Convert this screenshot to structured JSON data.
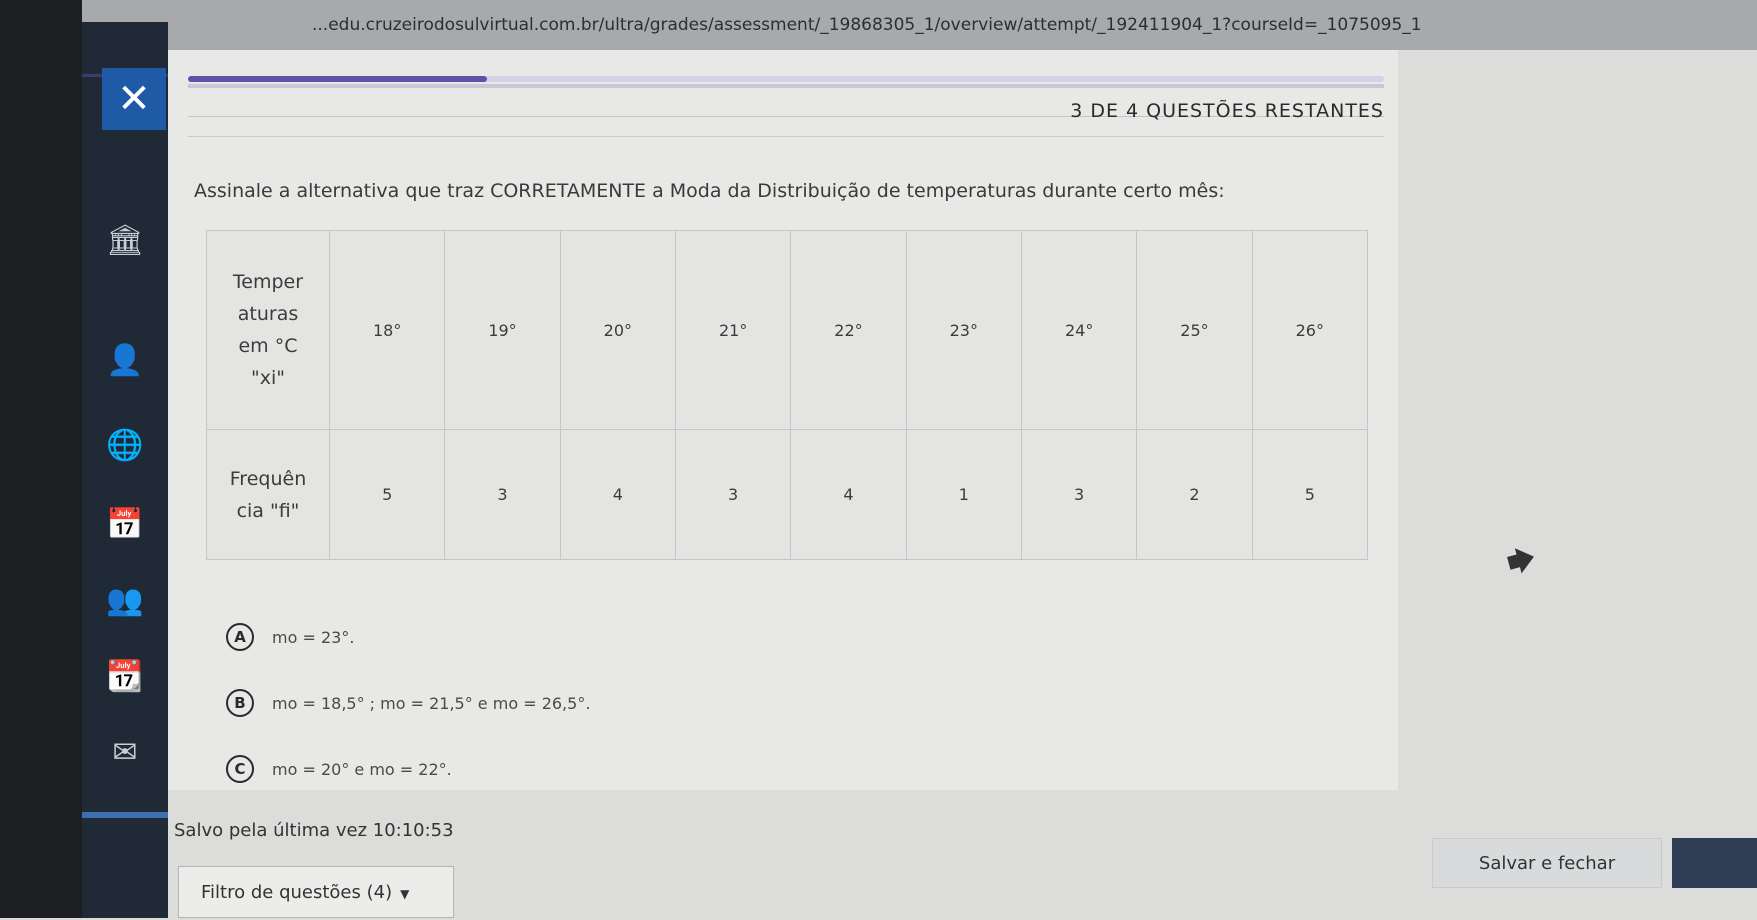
{
  "browser": {
    "url": "...edu.cruzeirodosulvirtual.com.br/ultra/grades/assessment/_19868305_1/overview/attempt/_192411904_1?courseId=_1075095_1"
  },
  "header": {
    "remaining": "3 DE 4 QUESTÕES RESTANTES",
    "progress_fraction": 0.25
  },
  "question": {
    "prompt": "Assinale a alternativa que traz CORRETAMENTE a Moda da Distribuição de temperaturas durante certo mês:",
    "table": {
      "row1_label": "Temper\naturas\nem °C\n\"xi\"",
      "row2_label": "Frequên\ncia \"fi\"",
      "temperatures": [
        "18°",
        "19°",
        "20°",
        "21°",
        "22°",
        "23°",
        "24°",
        "25°",
        "26°"
      ],
      "frequencies": [
        "5",
        "3",
        "4",
        "3",
        "4",
        "1",
        "3",
        "2",
        "5"
      ]
    },
    "options": [
      {
        "letter": "A",
        "text": "mo = 23°."
      },
      {
        "letter": "B",
        "text": "mo = 18,5° ; mo = 21,5° e mo = 26,5°."
      },
      {
        "letter": "C",
        "text": "mo = 20° e mo = 22°."
      }
    ]
  },
  "footer": {
    "saved_label": "Salvo pela última vez 10:10:53",
    "filter_label": "Filtro de questões (4)",
    "save_close_label": "Salvar e fechar"
  },
  "icons": {
    "close": "close-icon",
    "sidebar": [
      "institution-icon",
      "user-icon",
      "globe-icon",
      "calendar-icon",
      "groups-icon",
      "grades-icon",
      "mail-icon"
    ]
  },
  "colors": {
    "close_button": "#1f5aa6",
    "progress": "#5d54a8",
    "sidebar": "#1f2a36"
  }
}
